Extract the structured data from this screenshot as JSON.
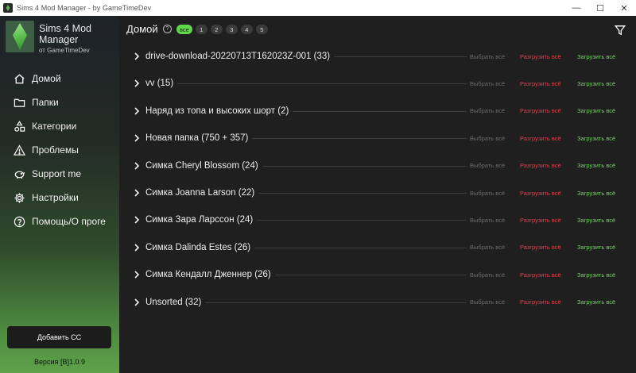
{
  "window": {
    "title": "Sims 4 Mod Manager - by GameTimeDev",
    "minimize": "—",
    "maximize": "☐",
    "close": "✕"
  },
  "sidebar": {
    "app_name": "Sims 4 Mod Manager",
    "author": "от GameTimeDev",
    "items": [
      {
        "label": "Домой",
        "icon": "home-icon"
      },
      {
        "label": "Папки",
        "icon": "folder-icon"
      },
      {
        "label": "Категории",
        "icon": "categories-icon"
      },
      {
        "label": "Проблемы",
        "icon": "warning-icon"
      },
      {
        "label": "Support me",
        "icon": "piggy-bank-icon"
      },
      {
        "label": "Настройки",
        "icon": "gear-icon"
      },
      {
        "label": "Помощь/О проге",
        "icon": "help-icon"
      }
    ],
    "add_button": "Добавить СС",
    "version": "Версия [B]1.0.9"
  },
  "header": {
    "title": "Домой",
    "help": "?",
    "tabs": [
      "все",
      "1",
      "2",
      "3",
      "4",
      "5"
    ],
    "active_tab": "все"
  },
  "actions": {
    "select_all": "Выбрать всё",
    "unload_all": "Разгрузить всё",
    "load_all": "Загрузить всё"
  },
  "folders": [
    {
      "name": "drive-download-20220713T162023Z-001 (33)"
    },
    {
      "name": "vv (15)"
    },
    {
      "name": "Наряд из топа и высоких шорт (2)"
    },
    {
      "name": "Новая папка (750 + 357)"
    },
    {
      "name": "Симка Cheryl Blossom (24)"
    },
    {
      "name": "Симка Joanna Larson (22)"
    },
    {
      "name": "Симка Зара Ларссон (24)"
    },
    {
      "name": "Симка Dalinda Estes (26)"
    },
    {
      "name": "Симка Кендалл Дженнер (26)"
    },
    {
      "name": "Unsorted (32)"
    }
  ],
  "colors": {
    "accent_green": "#5fd94b",
    "unload_red": "#e0404a",
    "load_green": "#6dd65a",
    "background": "#1f1f1f"
  }
}
